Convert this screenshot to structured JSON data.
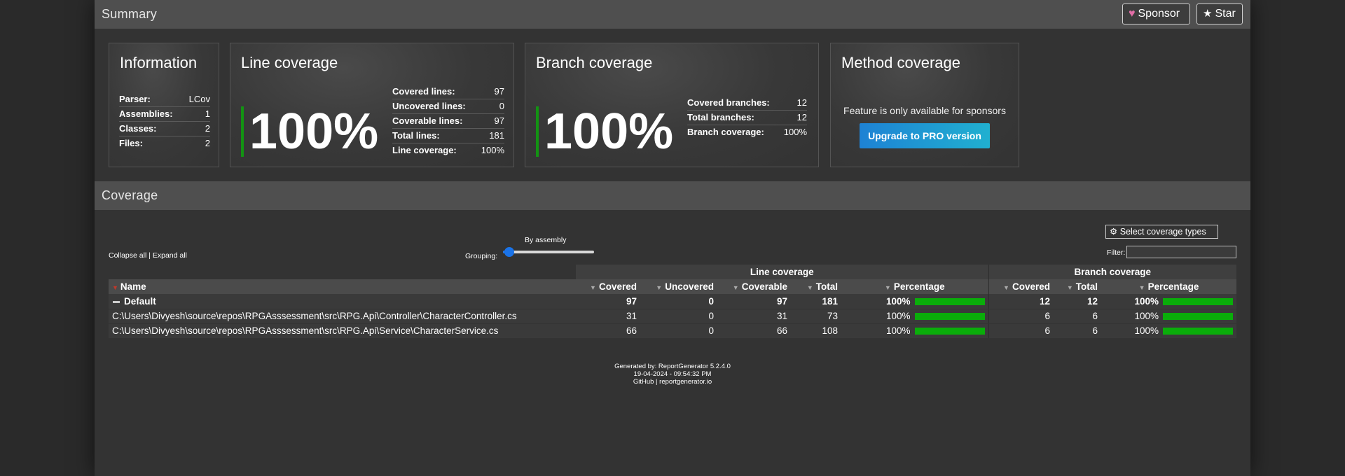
{
  "summary": {
    "title": "Summary",
    "sponsor_label": "Sponsor",
    "star_label": "Star"
  },
  "information": {
    "title": "Information",
    "rows": [
      {
        "label": "Parser:",
        "value": "LCov"
      },
      {
        "label": "Assemblies:",
        "value": "1"
      },
      {
        "label": "Classes:",
        "value": "2"
      },
      {
        "label": "Files:",
        "value": "2"
      }
    ]
  },
  "line_coverage": {
    "title": "Line coverage",
    "percent": "100%",
    "rows": [
      {
        "label": "Covered lines:",
        "value": "97"
      },
      {
        "label": "Uncovered lines:",
        "value": "0"
      },
      {
        "label": "Coverable lines:",
        "value": "97"
      },
      {
        "label": "Total lines:",
        "value": "181"
      },
      {
        "label": "Line coverage:",
        "value": "100%"
      }
    ]
  },
  "branch_coverage": {
    "title": "Branch coverage",
    "percent": "100%",
    "rows": [
      {
        "label": "Covered branches:",
        "value": "12"
      },
      {
        "label": "Total branches:",
        "value": "12"
      },
      {
        "label": "Branch coverage:",
        "value": "100%"
      }
    ]
  },
  "method_coverage": {
    "title": "Method coverage",
    "text": "Feature is only available for sponsors",
    "button": "Upgrade to PRO version"
  },
  "coverage": {
    "title": "Coverage",
    "collapse_all": "Collapse all",
    "separator": "|",
    "expand_all": "Expand all",
    "grouping_label": "Grouping:",
    "grouping_value": "By assembly",
    "grouping_level": 0,
    "select_types": "Select coverage types",
    "filter_label": "Filter:",
    "filter_value": "",
    "group_headers": {
      "line": "Line coverage",
      "branch": "Branch coverage"
    },
    "columns": {
      "name": "Name",
      "covered": "Covered",
      "uncovered": "Uncovered",
      "coverable": "Coverable",
      "total": "Total",
      "percentage": "Percentage",
      "b_covered": "Covered",
      "b_total": "Total",
      "b_percentage": "Percentage"
    },
    "rows": [
      {
        "name": "Default",
        "covered": "97",
        "uncovered": "0",
        "coverable": "97",
        "total": "181",
        "pct": "100%",
        "b_covered": "12",
        "b_total": "12",
        "b_pct": "100%",
        "line_fraction": 1.0,
        "branch_fraction": 1.0
      },
      {
        "name": "C:\\Users\\Divyesh\\source\\repos\\RPGAsssessment\\src\\RPG.Api\\Controller\\CharacterController.cs",
        "covered": "31",
        "uncovered": "0",
        "coverable": "31",
        "total": "73",
        "pct": "100%",
        "b_covered": "6",
        "b_total": "6",
        "b_pct": "100%",
        "line_fraction": 1.0,
        "branch_fraction": 1.0
      },
      {
        "name": "C:\\Users\\Divyesh\\source\\repos\\RPGAsssessment\\src\\RPG.Api\\Service\\CharacterService.cs",
        "covered": "66",
        "uncovered": "0",
        "coverable": "66",
        "total": "108",
        "pct": "100%",
        "b_covered": "6",
        "b_total": "6",
        "b_pct": "100%",
        "line_fraction": 1.0,
        "branch_fraction": 1.0
      }
    ]
  },
  "footer": {
    "generated_by": "Generated by: ReportGenerator 5.2.4.0",
    "timestamp": "19-04-2024 - 09:54:32 PM",
    "github": "GitHub",
    "separator": "|",
    "site": "reportgenerator.io"
  },
  "colors": {
    "accent_green": "#139313",
    "bar_green": "#0aad0a",
    "pro_button": "#1e82d4",
    "heart": "#e26ea6"
  },
  "icons": [
    "heart-icon",
    "star-icon",
    "gear-icon",
    "sort-arrow-icon",
    "collapse-minus-icon"
  ]
}
